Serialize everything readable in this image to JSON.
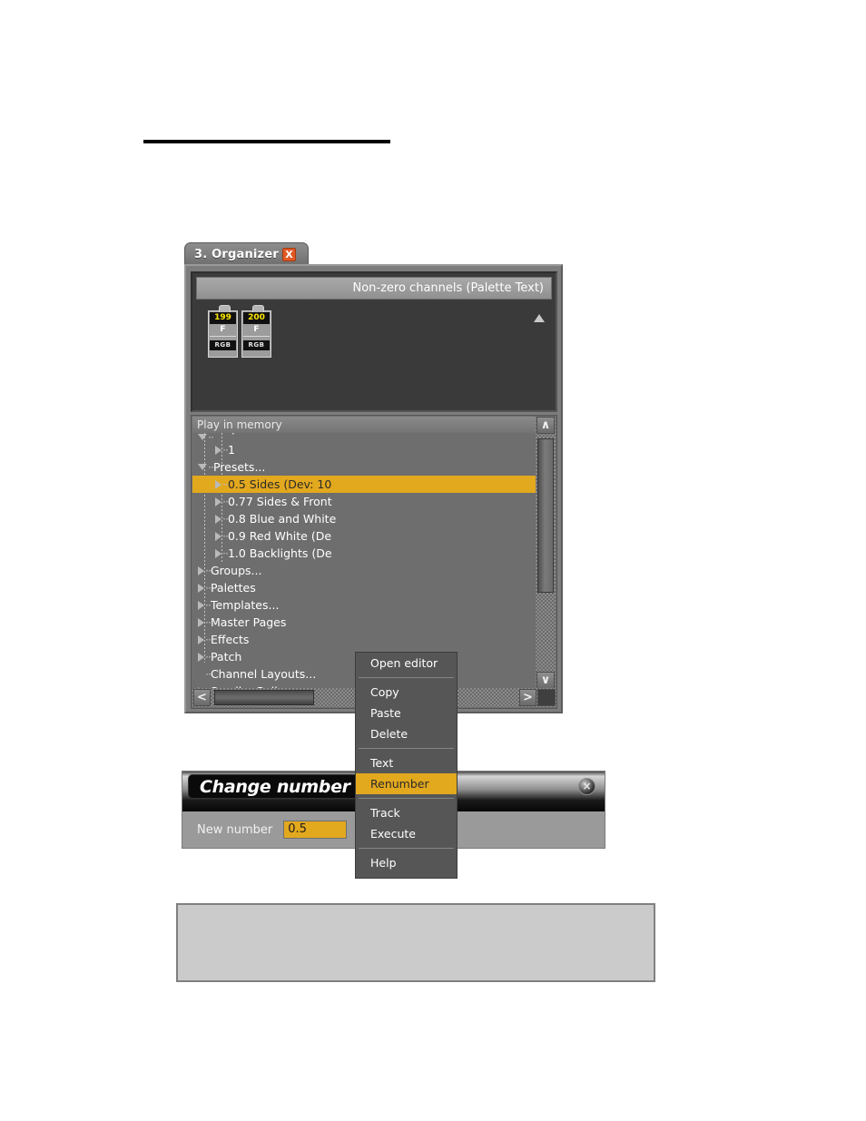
{
  "page": {
    "rule": ""
  },
  "organizer": {
    "tab_label": "3. Organizer",
    "close_label": "X",
    "channels_header": "Non-zero channels (Palette Text)",
    "fixtures": [
      {
        "number": "199",
        "mode": "F",
        "attr": "RGB"
      },
      {
        "number": "200",
        "mode": "F",
        "attr": "RGB"
      }
    ],
    "tree_title": "Play in memory",
    "tree_items": [
      {
        "label": "Sequences...",
        "indent": 0,
        "marker": "down",
        "clipped": "top",
        "selected": false
      },
      {
        "label": "1",
        "indent": 1,
        "marker": "right",
        "clipped": "",
        "selected": false
      },
      {
        "label": "Presets...",
        "indent": 0,
        "marker": "down",
        "clipped": "",
        "selected": false
      },
      {
        "label": "0.5 Sides (Dev: 10",
        "indent": 1,
        "marker": "right",
        "clipped": "",
        "selected": true
      },
      {
        "label": "0.77 Sides & Front",
        "indent": 1,
        "marker": "right",
        "clipped": "",
        "selected": false
      },
      {
        "label": "0.8 Blue and White",
        "indent": 1,
        "marker": "right",
        "clipped": "",
        "selected": false
      },
      {
        "label": "0.9 Red White (De",
        "indent": 1,
        "marker": "right",
        "clipped": "",
        "selected": false
      },
      {
        "label": "1.0 Backlights (De",
        "indent": 1,
        "marker": "right",
        "clipped": "",
        "selected": false
      },
      {
        "label": "Groups...",
        "indent": 0,
        "marker": "right",
        "clipped": "",
        "selected": false
      },
      {
        "label": "Palettes",
        "indent": 0,
        "marker": "right",
        "clipped": "",
        "selected": false
      },
      {
        "label": "Templates...",
        "indent": 0,
        "marker": "right",
        "clipped": "",
        "selected": false
      },
      {
        "label": "Master Pages",
        "indent": 0,
        "marker": "right",
        "clipped": "",
        "selected": false
      },
      {
        "label": "Effects",
        "indent": 0,
        "marker": "right",
        "clipped": "",
        "selected": false
      },
      {
        "label": "Patch",
        "indent": 0,
        "marker": "right",
        "clipped": "",
        "selected": false
      },
      {
        "label": "Channel Layouts...",
        "indent": 0,
        "marker": "none",
        "clipped": "",
        "selected": false
      },
      {
        "label": "Scroller Rolls",
        "indent": 0,
        "marker": "right",
        "clipped": "bottom",
        "selected": false
      }
    ],
    "scroll_up_label": "∧",
    "scroll_down_label": "∨",
    "scroll_left_label": "<",
    "scroll_right_label": ">"
  },
  "context_menu": {
    "items": [
      {
        "label": "Open editor",
        "highlighted": false,
        "separator_after": true
      },
      {
        "label": "Copy",
        "highlighted": false,
        "separator_after": false
      },
      {
        "label": "Paste",
        "highlighted": false,
        "separator_after": false
      },
      {
        "label": "Delete",
        "highlighted": false,
        "separator_after": true
      },
      {
        "label": "Text",
        "highlighted": false,
        "separator_after": false
      },
      {
        "label": "Renumber",
        "highlighted": true,
        "separator_after": true
      },
      {
        "label": "Track",
        "highlighted": false,
        "separator_after": false
      },
      {
        "label": "Execute",
        "highlighted": false,
        "separator_after": true
      },
      {
        "label": "Help",
        "highlighted": false,
        "separator_after": false
      }
    ]
  },
  "dialog": {
    "title": "Change number",
    "close_label": "×",
    "field_label": "New number",
    "field_value": "0.5"
  },
  "colors": {
    "highlight": "#e2a81e",
    "panel": "#7d7d7d",
    "dark_pane": "#3b3b3b",
    "fixture_number": "#ffe800",
    "tab_close": "#e25822",
    "note_box": "#cbcbcb"
  }
}
